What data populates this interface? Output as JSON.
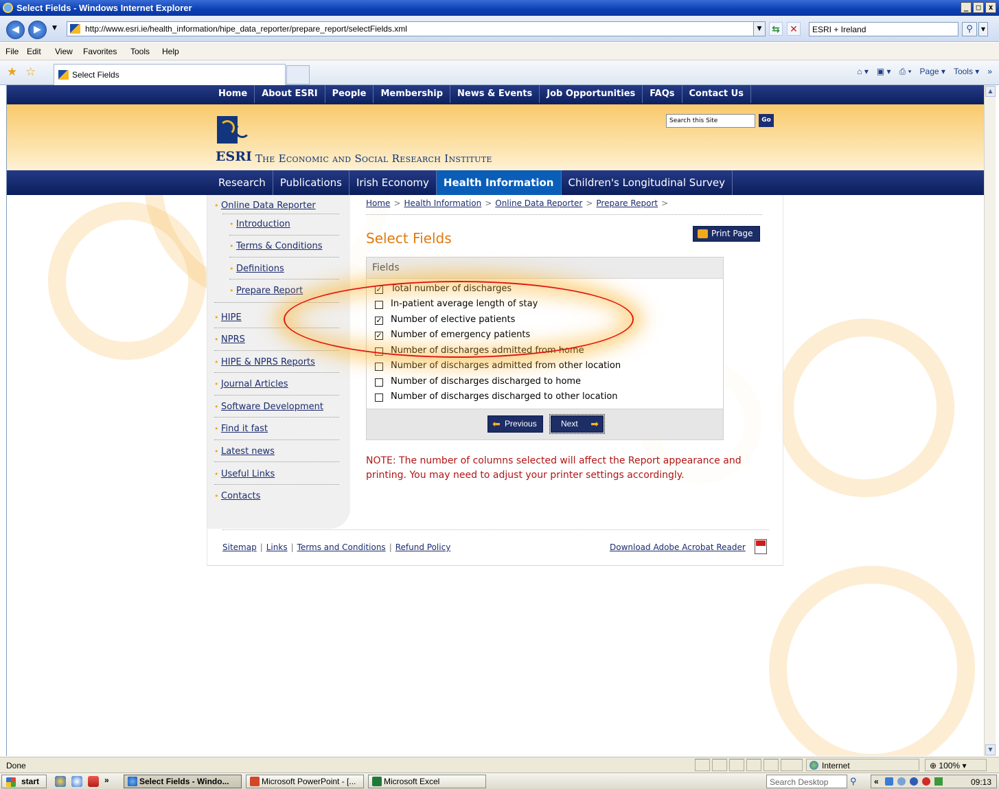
{
  "window": {
    "title": "Select Fields - Windows Internet Explorer",
    "minimize": "_",
    "maximize": "□",
    "close": "x"
  },
  "browser": {
    "url": "http://www.esri.ie/health_information/hipe_data_reporter/prepare_report/selectFields.xml",
    "search_value": "ESRI + Ireland",
    "menu": [
      "File",
      "Edit",
      "View",
      "Favorites",
      "Tools",
      "Help"
    ],
    "tab_title": "Select Fields",
    "commands": [
      "Page",
      "Tools"
    ]
  },
  "site": {
    "top_nav": [
      "Home",
      "About ESRI",
      "People",
      "Membership",
      "News & Events",
      "Job Opportunities",
      "FAQs",
      "Contact Us"
    ],
    "logo_abbr": "ESRI",
    "org_name": "The Economic and Social Research Institute",
    "search_placeholder": "Search this Site",
    "search_go": "Go",
    "main_nav": [
      "Research",
      "Publications",
      "Irish Economy",
      "Health Information",
      "Children's Longitudinal Survey"
    ],
    "main_nav_active": "Health Information"
  },
  "sidebar": {
    "items": [
      "Online Data Reporter",
      "Introduction",
      "Terms & Conditions",
      "Definitions",
      "Prepare Report",
      "HIPE",
      "NPRS",
      "HIPE & NPRS Reports",
      "Journal Articles",
      "Software Development",
      "Find it fast",
      "Latest news",
      "Useful Links",
      "Contacts"
    ]
  },
  "breadcrumb": {
    "items": [
      "Home",
      "Health Information",
      "Online Data Reporter",
      "Prepare Report"
    ],
    "separator": ">"
  },
  "main": {
    "title": "Select Fields",
    "print_label": "Print Page",
    "fields_heading": "Fields",
    "fields": [
      {
        "label": "Total number of discharges",
        "checked": true
      },
      {
        "label": "In-patient average length of stay",
        "checked": false
      },
      {
        "label": "Number of elective patients",
        "checked": true
      },
      {
        "label": "Number of emergency patients",
        "checked": true
      },
      {
        "label": "Number of discharges admitted from home",
        "checked": false
      },
      {
        "label": "Number of discharges admitted from other location",
        "checked": false
      },
      {
        "label": "Number of discharges discharged to home",
        "checked": false
      },
      {
        "label": "Number of discharges discharged to other location",
        "checked": false
      }
    ],
    "check_mark": "✓",
    "previous_label": "Previous",
    "next_label": "Next",
    "note": "NOTE: The number of columns selected will affect the Report appearance and printing. You may need to adjust your printer settings accordingly."
  },
  "footer": {
    "links": [
      "Sitemap",
      "Links",
      "Terms and Conditions",
      "Refund Policy"
    ],
    "separator": "|",
    "acrobat": "Download Adobe Acrobat Reader"
  },
  "status": {
    "text": "Done",
    "zone": "Internet",
    "zoom": "100%"
  },
  "taskbar": {
    "start": "start",
    "tasks": [
      "Select Fields - Windo...",
      "Microsoft PowerPoint - [...",
      "Microsoft Excel"
    ],
    "search_placeholder": "Search Desktop",
    "time": "09:13"
  },
  "colors": {
    "nav_blue": "#0c1f5e",
    "active_tab": "#0b5eb8",
    "title_orange": "#e07a10",
    "note_red": "#b01515",
    "highlight_red": "#e01515"
  }
}
